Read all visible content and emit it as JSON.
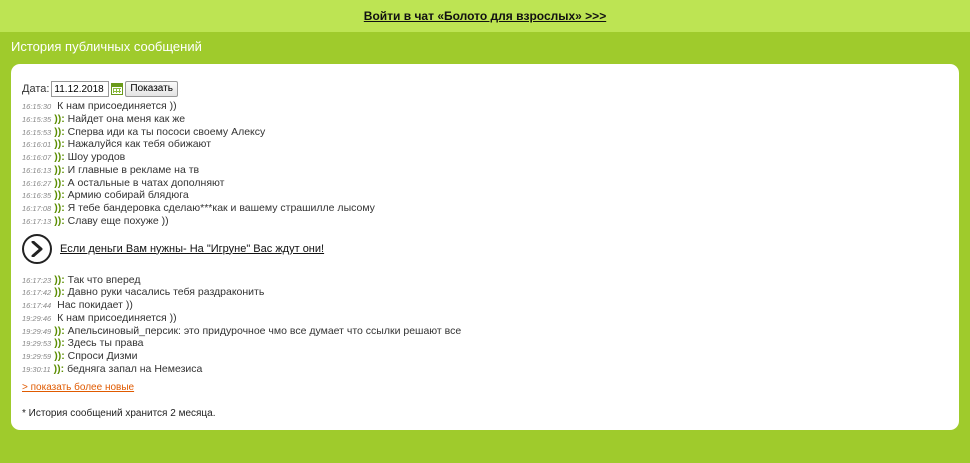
{
  "topbar": {
    "link_label": "Войти в чат «Болото для взрослых» >>>"
  },
  "header": {
    "title": "История публичных сообщений"
  },
  "datebar": {
    "label": "Дата:",
    "date_value": "11.12.2018",
    "show_label": "Показать"
  },
  "messages_a": [
    {
      "time": "16:15:30",
      "nick": "",
      "text": "К нам присоединяется ))"
    },
    {
      "time": "16:15:35",
      "nick": ")):",
      "text": "Найдет она меня как же"
    },
    {
      "time": "16:15:53",
      "nick": ")):",
      "text": "Сперва иди ка ты пососи своему Алексу"
    },
    {
      "time": "16:16:01",
      "nick": ")):",
      "text": "Нажалуйся как тебя обижают"
    },
    {
      "time": "16:16:07",
      "nick": ")):",
      "text": "Шоу уродов"
    },
    {
      "time": "16:16:13",
      "nick": ")):",
      "text": "И главные в рекламе на тв"
    },
    {
      "time": "16:16:27",
      "nick": ")):",
      "text": "А остальные в чатах дополняют"
    },
    {
      "time": "16:16:35",
      "nick": ")):",
      "text": "Армию собирай блядюга"
    },
    {
      "time": "16:17:08",
      "nick": ")):",
      "text": "Я тебе бандеровка сделаю***как и вашему страшилле лысому"
    },
    {
      "time": "16:17:13",
      "nick": ")):",
      "text": "Славу еще похуже ))"
    }
  ],
  "promo": {
    "link_label": "Если деньги Вам нужны- На \"Игруне\" Вас ждут они!"
  },
  "messages_b": [
    {
      "time": "16:17:23",
      "nick": ")):",
      "text": "Так что вперед"
    },
    {
      "time": "16:17:42",
      "nick": ")):",
      "text": "Давно руки часались тебя раздраконить"
    },
    {
      "time": "16:17:44",
      "nick": "",
      "text": "Нас покидает ))"
    },
    {
      "time": "19:29:46",
      "nick": "",
      "text": "К нам присоединяется ))"
    },
    {
      "time": "19:29:49",
      "nick": ")):",
      "text": "Апельсиновый_персик: это придурочное чмо все думает что ссылки решают все"
    },
    {
      "time": "19:29:53",
      "nick": ")):",
      "text": "Здесь ты права"
    },
    {
      "time": "19:29:59",
      "nick": ")):",
      "text": "Спроси Дизми"
    },
    {
      "time": "19:30:11",
      "nick": ")):",
      "text": "бедняга запал на Немезиса"
    }
  ],
  "more_link": "> показать более новые",
  "note": "* История сообщений хранится 2 месяца."
}
